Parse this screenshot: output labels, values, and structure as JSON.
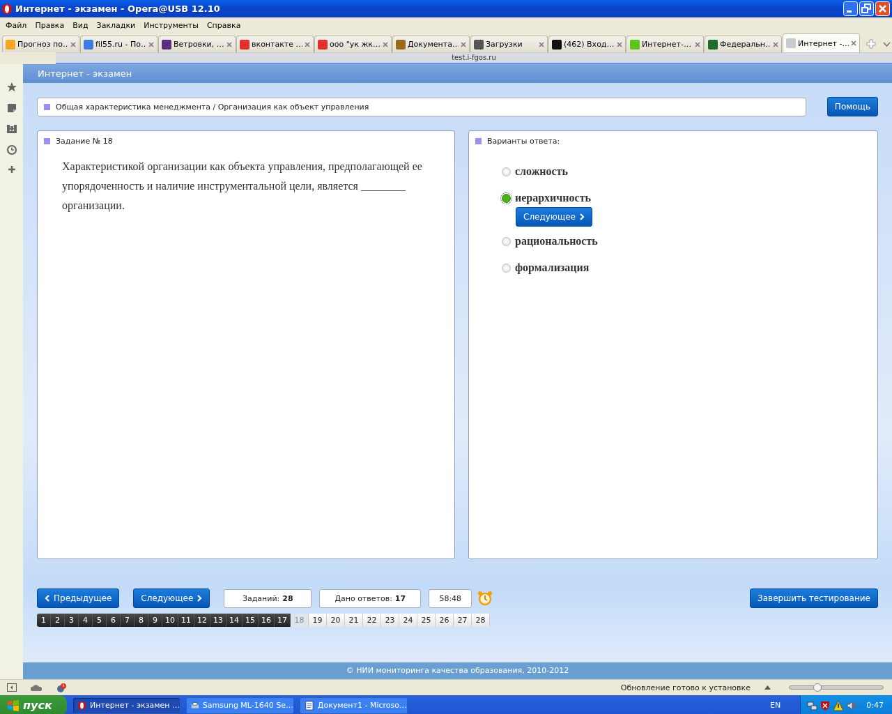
{
  "window": {
    "title": "Интернет - экзамен - Opera@USB 12.10"
  },
  "menu": [
    "Файл",
    "Правка",
    "Вид",
    "Закладки",
    "Инструменты",
    "Справка"
  ],
  "tabs": [
    {
      "label": "Прогноз по…",
      "selected": false,
      "color": "#f5a623"
    },
    {
      "label": "fil55.ru - По…",
      "selected": false,
      "color": "#3d7de0"
    },
    {
      "label": "Ветровки, …",
      "selected": false,
      "color": "#5a2d82"
    },
    {
      "label": "вконтакте …",
      "selected": false,
      "color": "#e03030"
    },
    {
      "label": "ооо \"ук жк…",
      "selected": false,
      "color": "#e03030"
    },
    {
      "label": "Документа…",
      "selected": false,
      "color": "#9a6a1a"
    },
    {
      "label": "Загрузки",
      "selected": false,
      "color": "#555555"
    },
    {
      "label": "(462) Вход…",
      "selected": false,
      "color": "#111111"
    },
    {
      "label": "Интернет-…",
      "selected": false,
      "color": "#5cc41c"
    },
    {
      "label": "Федеральн…",
      "selected": false,
      "color": "#1e6b2a"
    },
    {
      "label": "Интернет -…",
      "selected": true,
      "color": "#c8ccd0"
    }
  ],
  "address": "test.i-fgos.ru",
  "page": {
    "header": "Интернет - экзамен",
    "breadcrumb": "Общая характеристика менеджмента / Организация как объект управления",
    "help_button": "Помощь",
    "task": {
      "title": "Задание № 18",
      "text": "Характеристикой организации как объекта управления, предполагающей ее упорядоченность и наличие инструментальной цели, является ________ организации."
    },
    "answers": {
      "title": "Варианты ответа:",
      "next_button": "Следующее",
      "options": [
        {
          "label": "сложность",
          "selected": false
        },
        {
          "label": "иерархичность",
          "selected": true
        },
        {
          "label": "рациональность",
          "selected": false
        },
        {
          "label": "формализация",
          "selected": false
        }
      ]
    },
    "nav": {
      "prev": "Предыдущее",
      "next": "Следующее",
      "tasks_label": "Заданий:",
      "tasks_count": "28",
      "answered_label": "Дано ответов:",
      "answered_count": "17",
      "timer": "58:48",
      "finish": "Завершить тестирование"
    },
    "questions": [
      {
        "label": "1",
        "answered": true,
        "selected": false
      },
      {
        "label": "2",
        "answered": true,
        "selected": false
      },
      {
        "label": "3",
        "answered": true,
        "selected": false
      },
      {
        "label": "4",
        "answered": true,
        "selected": false
      },
      {
        "label": "5",
        "answered": true,
        "selected": false
      },
      {
        "label": "6",
        "answered": true,
        "selected": false
      },
      {
        "label": "7",
        "answered": true,
        "selected": false
      },
      {
        "label": "8",
        "answered": true,
        "selected": false
      },
      {
        "label": "9",
        "answered": true,
        "selected": false
      },
      {
        "label": "10",
        "answered": true,
        "selected": false
      },
      {
        "label": "11",
        "answered": true,
        "selected": false
      },
      {
        "label": "12",
        "answered": true,
        "selected": false
      },
      {
        "label": "13",
        "answered": true,
        "selected": false
      },
      {
        "label": "14",
        "answered": true,
        "selected": false
      },
      {
        "label": "15",
        "answered": true,
        "selected": false
      },
      {
        "label": "16",
        "answered": true,
        "selected": false
      },
      {
        "label": "17",
        "answered": true,
        "selected": false
      },
      {
        "label": "18",
        "answered": false,
        "selected": true
      },
      {
        "label": "19",
        "answered": false,
        "selected": false
      },
      {
        "label": "20",
        "answered": false,
        "selected": false
      },
      {
        "label": "21",
        "answered": false,
        "selected": false
      },
      {
        "label": "22",
        "answered": false,
        "selected": false
      },
      {
        "label": "23",
        "answered": false,
        "selected": false
      },
      {
        "label": "24",
        "answered": false,
        "selected": false
      },
      {
        "label": "25",
        "answered": false,
        "selected": false
      },
      {
        "label": "26",
        "answered": false,
        "selected": false
      },
      {
        "label": "27",
        "answered": false,
        "selected": false
      },
      {
        "label": "28",
        "answered": false,
        "selected": false
      }
    ],
    "footer": "© НИИ мониторинга качества образования, 2010-2012"
  },
  "status_bar": {
    "message": "Обновление готово к установке",
    "zoom": {
      "level": 0.3
    }
  },
  "taskbar": {
    "start": "пуск",
    "tasks": [
      {
        "label": "Интернет - экзамен …",
        "selected": true
      },
      {
        "label": "Samsung ML-1640 Se…",
        "selected": false
      },
      {
        "label": "Документ1 - Microso…",
        "selected": false
      }
    ],
    "language": "EN",
    "clock": "0:47"
  }
}
